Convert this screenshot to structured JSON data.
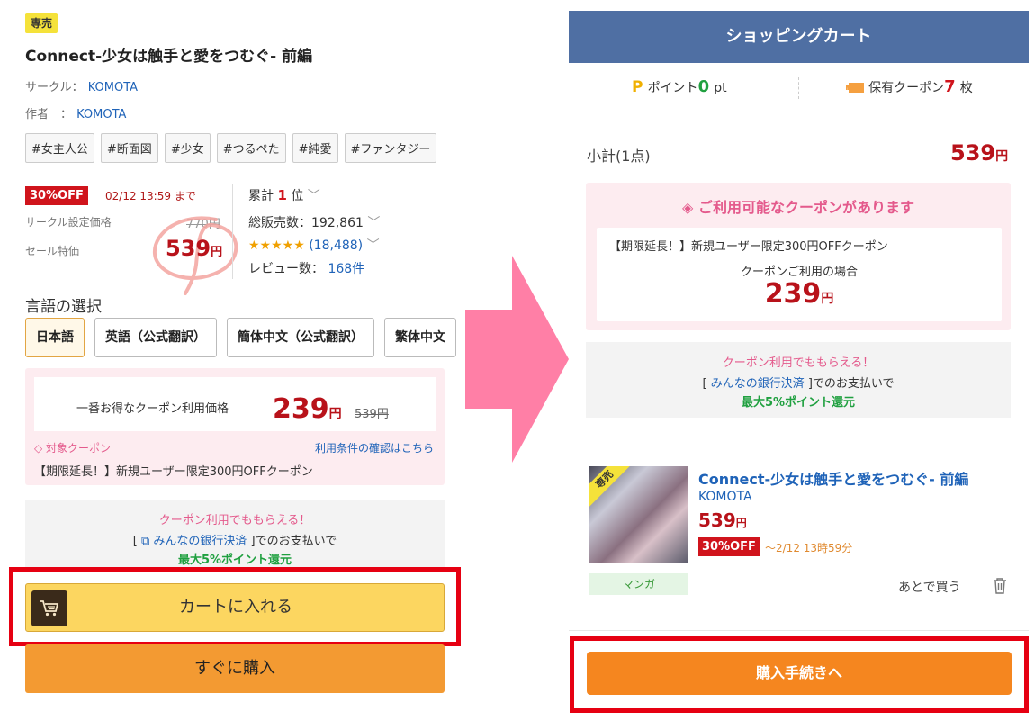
{
  "left": {
    "exclusive_badge": "専売",
    "title": "Connect-少女は触手と愛をつむぐ- 前編",
    "circle_label": "サークル：",
    "circle_name": "KOMOTA",
    "author_label": "作者　：",
    "author_name": "KOMOTA",
    "tags": [
      "#女主人公",
      "#断面図",
      "#少女",
      "#つるぺた",
      "#純愛",
      "#ファンタジー"
    ],
    "sale_badge": "30%OFF",
    "sale_deadline": "02/12 13:59 まで",
    "circle_price_label": "サークル設定価格",
    "circle_price": "770円",
    "sale_price_label": "セール特価",
    "sale_price": "539",
    "yen": "円",
    "rank_label": "累計",
    "rank_num": "1",
    "rank_unit": "位",
    "sales_label": "総販売数：192,861",
    "stars": "★★★★★",
    "rating_count": "(18,488)",
    "review_label": "レビュー数：",
    "review_count": "168件",
    "lang_title": "言語の選択",
    "languages": [
      "日本語",
      "英語（公式翻訳）",
      "簡体中文（公式翻訳）",
      "繁体中文"
    ],
    "coupon_best_label": "一番お得なクーポン利用価格",
    "coupon_price": "239",
    "coupon_old_price": "539円",
    "target_coupon": "◇ 対象クーポン",
    "terms_link": "利用条件の確認はこちら",
    "coupon_name": "【期限延長！】新規ユーザー限定300円OFFクーポン",
    "bank_line1": "クーポン利用でももらえる！",
    "bank_open": "[ ",
    "bank_link": "⧉ みんなの銀行決済",
    "bank_close": " ]でのお支払いで",
    "bank_line3": "最大5%ポイント還元",
    "cart_button": "カートに入れる",
    "buy_now": "すぐに購入"
  },
  "right": {
    "header": "ショッピングカート",
    "points_label": "ポイント",
    "points_value": "0",
    "points_unit": "pt",
    "coupon_label": "保有クーポン",
    "coupon_count": "7",
    "coupon_unit": "枚",
    "subtotal_label": "小計(1点)",
    "subtotal_value": "539",
    "yen": "円",
    "coupon_available": "ご利用可能なクーポンがあります",
    "coupon_name": "【期限延長！】新規ユーザー限定300円OFFクーポン",
    "coupon_use_label": "クーポンご利用の場合",
    "coupon_price": "239",
    "bank_line1": "クーポン利用でももらえる！",
    "bank_open": "[ ",
    "bank_link": "みんなの銀行決済",
    "bank_close": " ]でのお支払いで",
    "bank_line3": "最大5%ポイント還元",
    "item_badge": "専売",
    "item_title": "Connect-少女は触手と愛をつむぐ- 前編",
    "item_author": "KOMOTA",
    "item_price": "539",
    "item_sale": "30%OFF",
    "item_deadline": "～2/12 13時59分",
    "item_category": "マンガ",
    "later_label": "あとで買う",
    "checkout_button": "購入手続きへ"
  },
  "colors": {
    "highlight_frame": "#e60012",
    "arrow": "#ff7fa6",
    "header_blue": "#4f6fa3",
    "price_red": "#b8121a"
  }
}
